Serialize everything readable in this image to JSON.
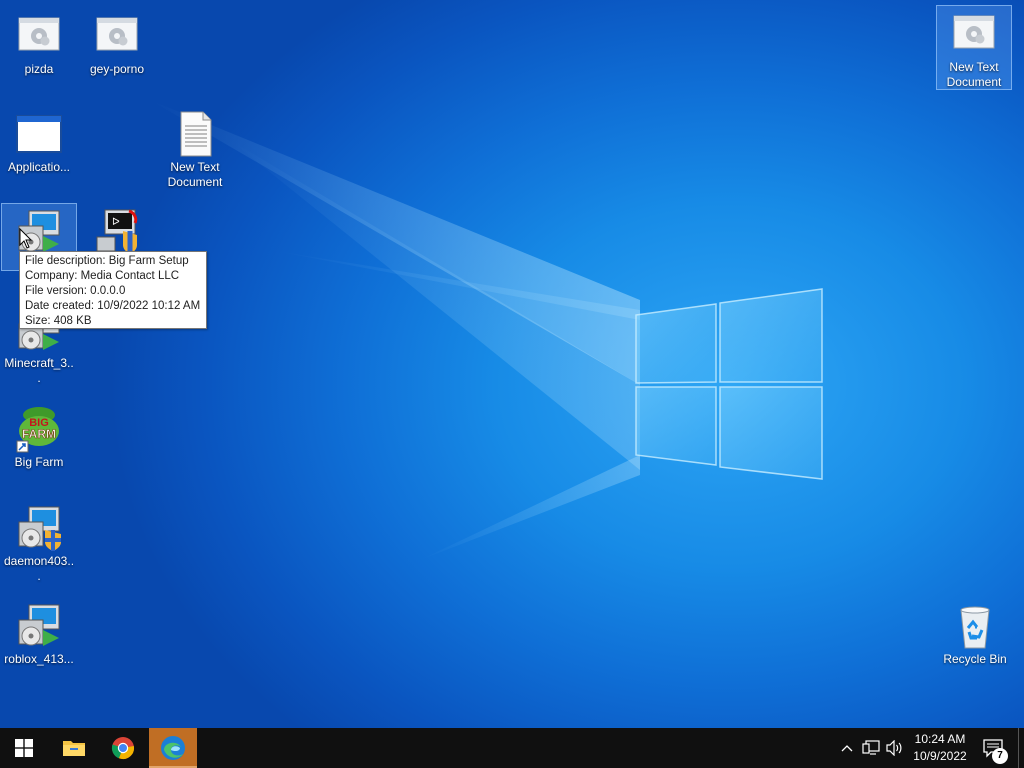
{
  "desktop": {
    "icons": [
      {
        "id": "pizda",
        "label": "pizda",
        "icon": "window-gear-icon"
      },
      {
        "id": "gey-porno",
        "label": "gey-porno",
        "icon": "window-gear-icon"
      },
      {
        "id": "new-text-document-top",
        "label": "New Text Document",
        "icon": "window-gear-icon",
        "selected": true
      },
      {
        "id": "application",
        "label": "Applicatio...",
        "icon": "application-window-icon"
      },
      {
        "id": "new-text-document",
        "label": "New Text Document",
        "icon": "text-document-icon"
      },
      {
        "id": "big-farm-setup",
        "label": "Big Farm Setup",
        "icon": "installer-icon",
        "selected": true
      },
      {
        "id": "unknown-installer",
        "label": "",
        "icon": "terminal-shield-icon"
      },
      {
        "id": "minecraft",
        "label": "Minecraft_3...",
        "icon": "installer-icon"
      },
      {
        "id": "big-farm",
        "label": "Big Farm",
        "icon": "big-farm-icon"
      },
      {
        "id": "daemon",
        "label": "daemon403...",
        "icon": "installer-shield-icon"
      },
      {
        "id": "roblox",
        "label": "roblox_413...",
        "icon": "installer-icon"
      },
      {
        "id": "recycle-bin",
        "label": "Recycle Bin",
        "icon": "recycle-bin-icon"
      }
    ]
  },
  "tooltip": {
    "description": "File description: Big Farm Setup",
    "company": "Company: Media Contact LLC",
    "version": "File version: 0.0.0.0",
    "created": "Date created: 10/9/2022 10:12 AM",
    "size": "Size: 408 KB"
  },
  "taskbar": {
    "pinned": [
      {
        "name": "start-button",
        "icon": "windows-logo-icon"
      },
      {
        "name": "file-explorer-button",
        "icon": "folder-icon"
      },
      {
        "name": "chrome-button",
        "icon": "chrome-icon"
      },
      {
        "name": "edge-button",
        "icon": "edge-icon",
        "active": true
      }
    ],
    "tray": {
      "time": "10:24 AM",
      "date": "10/9/2022",
      "notification_count": "7"
    }
  },
  "colors": {
    "desktop_blue": "#0f6fd6",
    "taskbar": "#101010",
    "active_app": "#c06e24"
  }
}
